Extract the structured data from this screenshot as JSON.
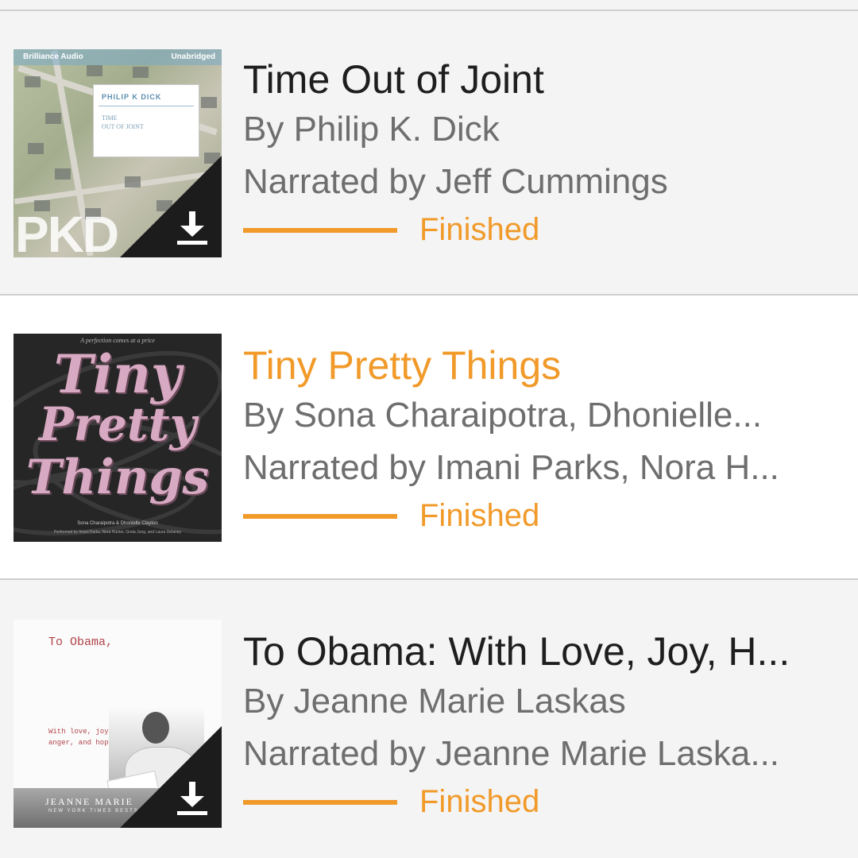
{
  "books": [
    {
      "title": "Time Out of Joint",
      "author_line": "By Philip K. Dick",
      "narrator_line": "Narrated by Jeff Cummings",
      "status": "Finished",
      "progress": 1.0,
      "highlighted": false,
      "downloaded": true,
      "cover": {
        "brand": "Brilliance Audio",
        "badge": "Unabridged",
        "author": "PHILIP K DICK",
        "title_line1": "TIME",
        "title_line2": "OUT OF JOINT",
        "mark": "PKD"
      }
    },
    {
      "title": "Tiny Pretty Things",
      "author_line": "By Sona Charaipotra, Dhonielle...",
      "narrator_line": "Narrated by Imani Parks, Nora H...",
      "status": "Finished",
      "progress": 1.0,
      "highlighted": true,
      "downloaded": false,
      "cover": {
        "tagline": "A perfection comes at a price",
        "word1": "Tiny",
        "word2": "Pretty",
        "word3": "Things",
        "authors": "Sona Charaipotra & Dhonielle Clayton",
        "performers": "Performed by Imani Parks, Nora Hunter, Greta Jung, and Laura Delaney"
      }
    },
    {
      "title": "To Obama: With Love, Joy, H...",
      "author_line": "By Jeanne Marie Laskas",
      "narrator_line": "Narrated by Jeanne Marie Laska...",
      "status": "Finished",
      "progress": 1.0,
      "highlighted": false,
      "downloaded": true,
      "cover": {
        "title": "To Obama,",
        "subtitle_line1": "With love, joy,",
        "subtitle_line2": "anger, and hope",
        "author": "JEANNE MARIE",
        "tag": "NEW YORK TIMES BESTSELLING"
      }
    }
  ],
  "colors": {
    "accent": "#f19a2a",
    "title_text": "#1e1e1e",
    "secondary_text": "#6e6e6e",
    "divider": "#cfcfcf"
  },
  "icons": {
    "download": "download-icon"
  }
}
